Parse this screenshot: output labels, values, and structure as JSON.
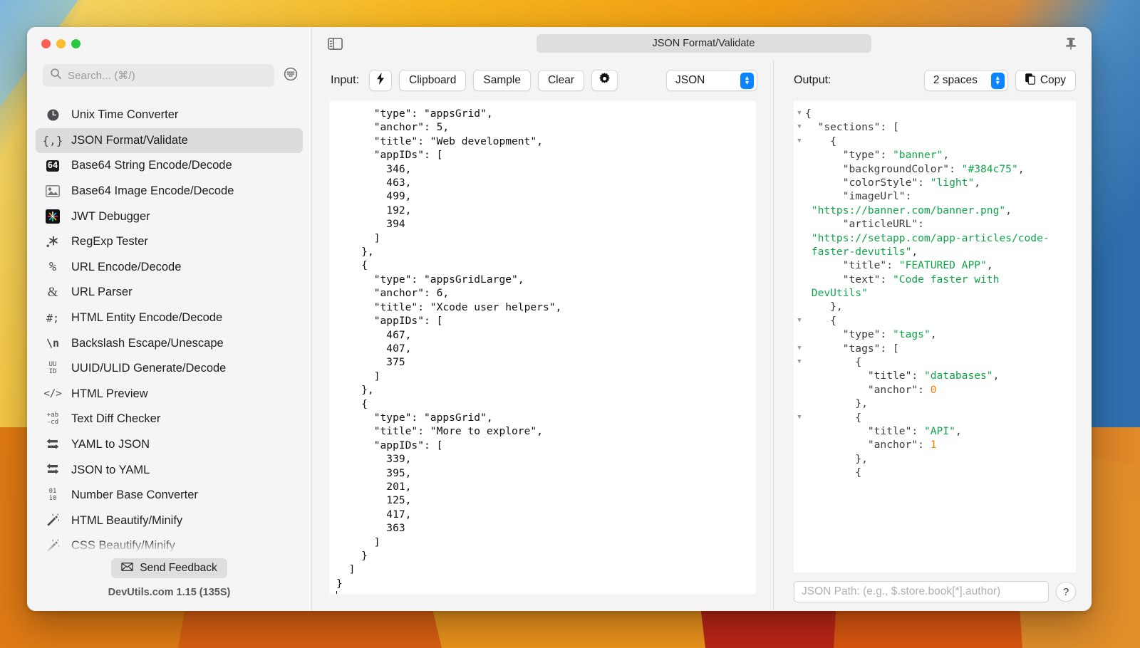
{
  "window": {
    "title": "JSON Format/Validate",
    "traffic_lights": [
      "close",
      "minimize",
      "zoom"
    ],
    "pin_icon": "pin-icon",
    "sidebar_toggle_icon": "sidebar-toggle-icon"
  },
  "sidebar": {
    "search": {
      "placeholder": "Search... (⌘/)",
      "icon": "search-icon",
      "filter_icon": "filter-icon"
    },
    "items": [
      {
        "label": "Unix Time Converter",
        "icon": "clock-icon"
      },
      {
        "label": "JSON Format/Validate",
        "icon": "braces-icon",
        "selected": true
      },
      {
        "label": "Base64 String Encode/Decode",
        "icon": "base64-badge-icon"
      },
      {
        "label": "Base64 Image Encode/Decode",
        "icon": "image-icon"
      },
      {
        "label": "JWT Debugger",
        "icon": "jwt-icon"
      },
      {
        "label": "RegExp Tester",
        "icon": "asterisk-icon"
      },
      {
        "label": "URL Encode/Decode",
        "icon": "percent-icon"
      },
      {
        "label": "URL Parser",
        "icon": "ampersand-icon"
      },
      {
        "label": "HTML Entity Encode/Decode",
        "icon": "hash-semicolon-icon"
      },
      {
        "label": "Backslash Escape/Unescape",
        "icon": "backslash-n-icon"
      },
      {
        "label": "UUID/ULID Generate/Decode",
        "icon": "uuid-icon"
      },
      {
        "label": "HTML Preview",
        "icon": "code-tag-icon"
      },
      {
        "label": "Text Diff Checker",
        "icon": "diff-icon"
      },
      {
        "label": "YAML to JSON",
        "icon": "swap-icon"
      },
      {
        "label": "JSON to YAML",
        "icon": "swap-icon"
      },
      {
        "label": "Number Base Converter",
        "icon": "binary-icon"
      },
      {
        "label": "HTML Beautify/Minify",
        "icon": "wand-icon"
      },
      {
        "label": "CSS Beautify/Minify",
        "icon": "wand-icon"
      }
    ],
    "feedback_button": "Send Feedback",
    "feedback_icon": "envelope-icon",
    "version": "DevUtils.com 1.15 (135S)"
  },
  "input_panel": {
    "label": "Input:",
    "buttons": [
      {
        "label": "",
        "icon": "bolt-icon",
        "name": "auto-detect-button"
      },
      {
        "label": "Clipboard",
        "icon": "",
        "name": "clipboard-button"
      },
      {
        "label": "Sample",
        "icon": "",
        "name": "sample-button"
      },
      {
        "label": "Clear",
        "icon": "",
        "name": "clear-button"
      },
      {
        "label": "",
        "icon": "gear-icon",
        "name": "settings-button"
      }
    ],
    "format_select": {
      "value": "JSON",
      "icon": "stepper-icon"
    },
    "code": "      \"type\": \"appsGrid\",\n      \"anchor\": 5,\n      \"title\": \"Web development\",\n      \"appIDs\": [\n        346,\n        463,\n        499,\n        192,\n        394\n      ]\n    },\n    {\n      \"type\": \"appsGridLarge\",\n      \"anchor\": 6,\n      \"title\": \"Xcode user helpers\",\n      \"appIDs\": [\n        467,\n        407,\n        375\n      ]\n    },\n    {\n      \"type\": \"appsGrid\",\n      \"title\": \"More to explore\",\n      \"appIDs\": [\n        339,\n        395,\n        201,\n        125,\n        417,\n        363\n      ]\n    }\n  ]\n}\n"
  },
  "output_panel": {
    "label": "Output:",
    "indent_select": {
      "value": "2 spaces",
      "icon": "stepper-icon"
    },
    "copy_button": {
      "label": "Copy",
      "icon": "copy-icon"
    },
    "jsonpath": {
      "placeholder": "JSON Path: (e.g., $.store.book[*].author)"
    },
    "help_button": "?",
    "colors": {
      "string": "#11a54a",
      "number": "#f08000",
      "key": "#3b3b3e"
    },
    "lines": [
      {
        "fold": true,
        "tokens": [
          {
            "t": "p",
            "v": "{"
          }
        ]
      },
      {
        "fold": true,
        "tokens": [
          {
            "t": "k",
            "v": "  \"sections\": ["
          }
        ]
      },
      {
        "fold": true,
        "tokens": [
          {
            "t": "k",
            "v": "    {"
          }
        ]
      },
      {
        "fold": false,
        "tokens": [
          {
            "t": "k",
            "v": "      \"type\": "
          },
          {
            "t": "s",
            "v": "\"banner\""
          },
          {
            "t": "p",
            "v": ","
          }
        ]
      },
      {
        "fold": false,
        "tokens": [
          {
            "t": "k",
            "v": "      \"backgroundColor\": "
          },
          {
            "t": "s",
            "v": "\"#384c75\""
          },
          {
            "t": "p",
            "v": ","
          }
        ]
      },
      {
        "fold": false,
        "tokens": [
          {
            "t": "k",
            "v": "      \"colorStyle\": "
          },
          {
            "t": "s",
            "v": "\"light\""
          },
          {
            "t": "p",
            "v": ","
          }
        ]
      },
      {
        "fold": false,
        "tokens": [
          {
            "t": "k",
            "v": "      \"imageUrl\":"
          }
        ]
      },
      {
        "fold": false,
        "tokens": [
          {
            "t": "s",
            "v": " \"https://banner.com/banner.png\""
          },
          {
            "t": "p",
            "v": ","
          }
        ]
      },
      {
        "fold": false,
        "tokens": [
          {
            "t": "k",
            "v": "      \"articleURL\":"
          }
        ]
      },
      {
        "fold": false,
        "tokens": [
          {
            "t": "s",
            "v": " \"https://setapp.com/app-articles/code-"
          }
        ]
      },
      {
        "fold": false,
        "tokens": [
          {
            "t": "s",
            "v": " faster-devutils\""
          },
          {
            "t": "p",
            "v": ","
          }
        ]
      },
      {
        "fold": false,
        "tokens": [
          {
            "t": "k",
            "v": "      \"title\": "
          },
          {
            "t": "s",
            "v": "\"FEATURED APP\""
          },
          {
            "t": "p",
            "v": ","
          }
        ]
      },
      {
        "fold": false,
        "tokens": [
          {
            "t": "k",
            "v": "      \"text\": "
          },
          {
            "t": "s",
            "v": "\"Code faster with"
          }
        ]
      },
      {
        "fold": false,
        "tokens": [
          {
            "t": "s",
            "v": " DevUtils\""
          }
        ]
      },
      {
        "fold": false,
        "tokens": [
          {
            "t": "p",
            "v": "    },"
          }
        ]
      },
      {
        "fold": true,
        "tokens": [
          {
            "t": "p",
            "v": "    {"
          }
        ]
      },
      {
        "fold": false,
        "tokens": [
          {
            "t": "k",
            "v": "      \"type\": "
          },
          {
            "t": "s",
            "v": "\"tags\""
          },
          {
            "t": "p",
            "v": ","
          }
        ]
      },
      {
        "fold": true,
        "tokens": [
          {
            "t": "k",
            "v": "      \"tags\": ["
          }
        ]
      },
      {
        "fold": true,
        "tokens": [
          {
            "t": "p",
            "v": "        {"
          }
        ]
      },
      {
        "fold": false,
        "tokens": [
          {
            "t": "k",
            "v": "          \"title\": "
          },
          {
            "t": "s",
            "v": "\"databases\""
          },
          {
            "t": "p",
            "v": ","
          }
        ]
      },
      {
        "fold": false,
        "tokens": [
          {
            "t": "k",
            "v": "          \"anchor\": "
          },
          {
            "t": "n",
            "v": "0"
          }
        ]
      },
      {
        "fold": false,
        "tokens": [
          {
            "t": "p",
            "v": "        },"
          }
        ]
      },
      {
        "fold": true,
        "tokens": [
          {
            "t": "p",
            "v": "        {"
          }
        ]
      },
      {
        "fold": false,
        "tokens": [
          {
            "t": "k",
            "v": "          \"title\": "
          },
          {
            "t": "s",
            "v": "\"API\""
          },
          {
            "t": "p",
            "v": ","
          }
        ]
      },
      {
        "fold": false,
        "tokens": [
          {
            "t": "k",
            "v": "          \"anchor\": "
          },
          {
            "t": "n",
            "v": "1"
          }
        ]
      },
      {
        "fold": false,
        "tokens": [
          {
            "t": "p",
            "v": "        },"
          }
        ]
      },
      {
        "fold": false,
        "tokens": [
          {
            "t": "p",
            "v": "        {"
          }
        ]
      }
    ]
  }
}
